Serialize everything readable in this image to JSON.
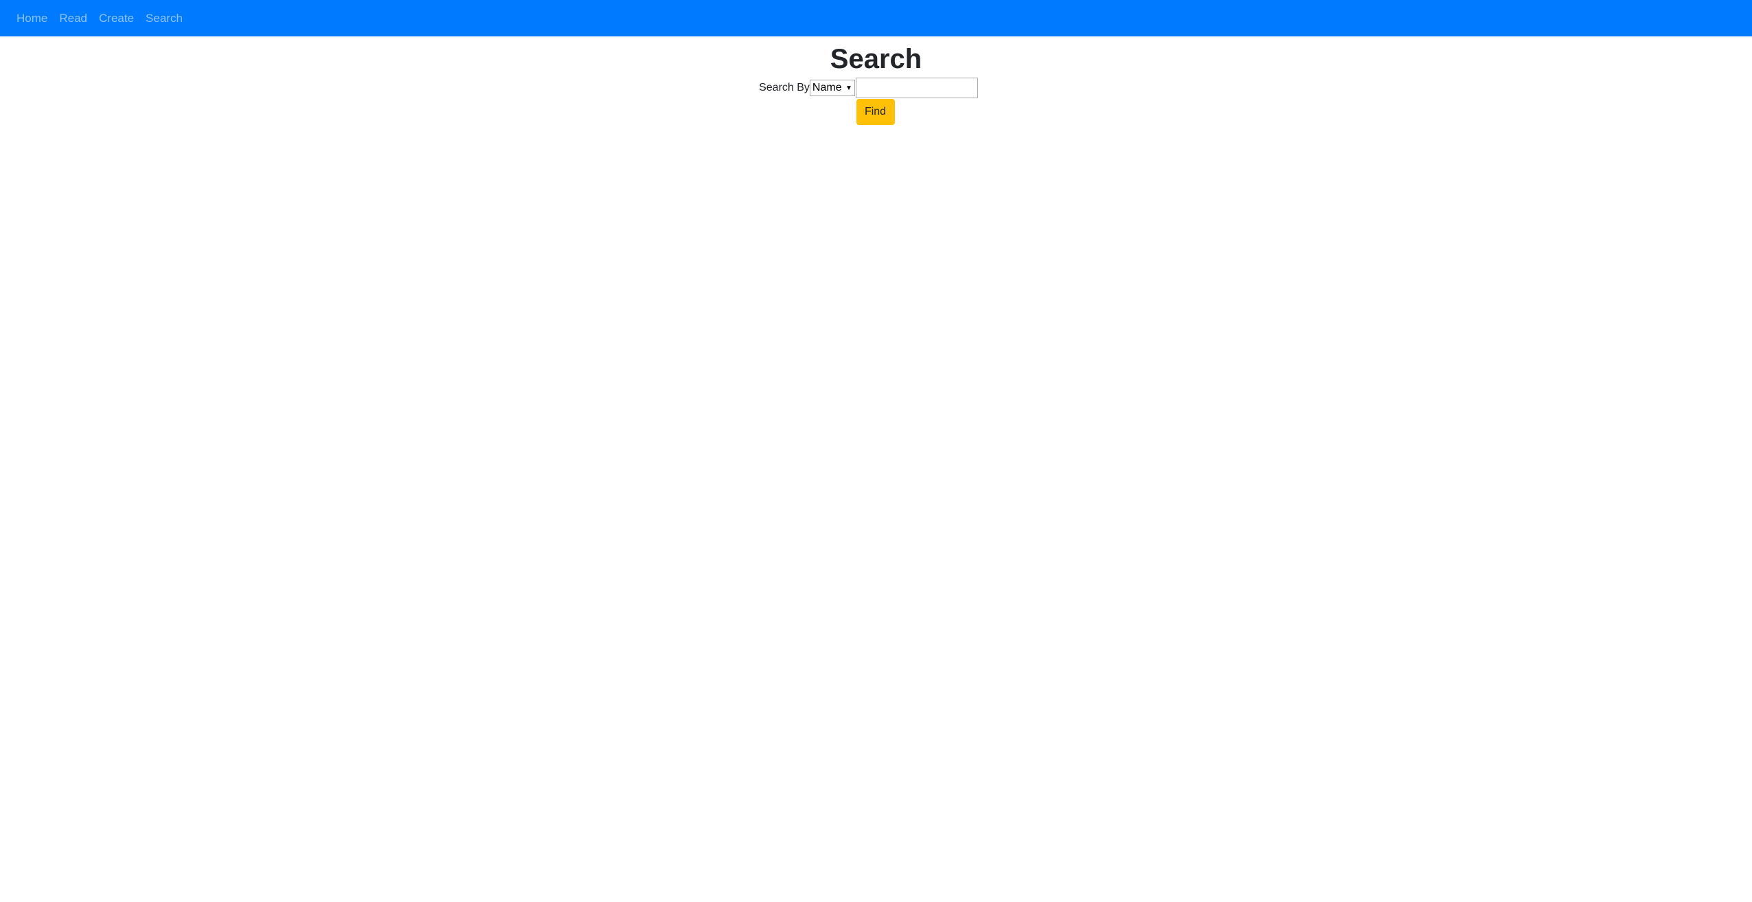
{
  "nav": {
    "items": [
      "Home",
      "Read",
      "Create",
      "Search"
    ]
  },
  "page": {
    "title": "Search"
  },
  "form": {
    "search_by_label": "Search By",
    "select_value": "Name",
    "input_value": "",
    "input_placeholder": "",
    "find_label": "Find"
  },
  "colors": {
    "navbar": "#007bff",
    "find_button": "#ffc107"
  }
}
